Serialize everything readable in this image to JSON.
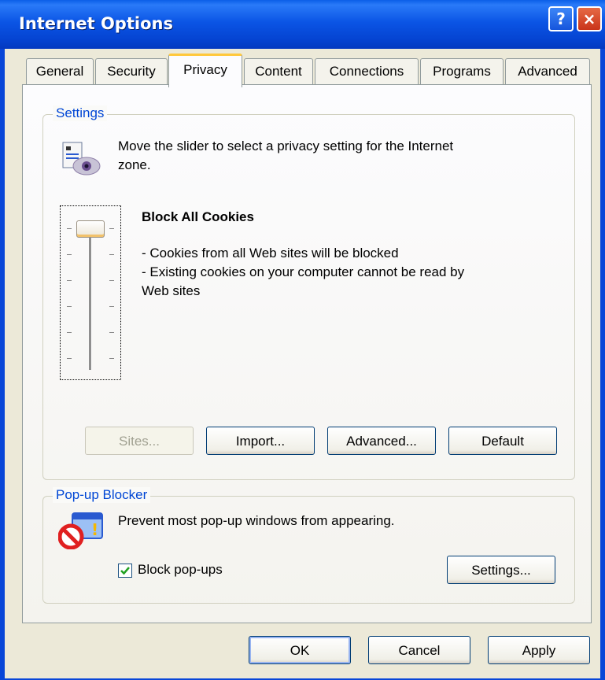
{
  "window": {
    "title": "Internet Options",
    "help_icon": "?",
    "close_icon": "×"
  },
  "tabs": [
    "General",
    "Security",
    "Privacy",
    "Content",
    "Connections",
    "Programs",
    "Advanced"
  ],
  "active_tab": "Privacy",
  "settings": {
    "group_title": "Settings",
    "description_line1": "Move the slider to select a privacy setting for the Internet",
    "description_line2": "zone.",
    "level_title": "Block All Cookies",
    "detail_1": "- Cookies from all Web sites will be blocked",
    "detail_2a": "- Existing cookies on your computer cannot be read by",
    "detail_2b": "Web sites",
    "slider_level": "highest (6 of 6)",
    "buttons": {
      "sites": "Sites...",
      "import": "Import...",
      "advanced": "Advanced...",
      "default": "Default"
    }
  },
  "popup": {
    "group_title": "Pop-up Blocker",
    "description": "Prevent most pop-up windows from appearing.",
    "checkbox_label": "Block pop-ups",
    "checkbox_checked": true,
    "settings_button": "Settings..."
  },
  "footer": {
    "ok": "OK",
    "cancel": "Cancel",
    "apply": "Apply"
  },
  "colors": {
    "title_bar": "#0846d8",
    "group_title": "#0046d5",
    "dialog_bg": "#ece9d8"
  }
}
